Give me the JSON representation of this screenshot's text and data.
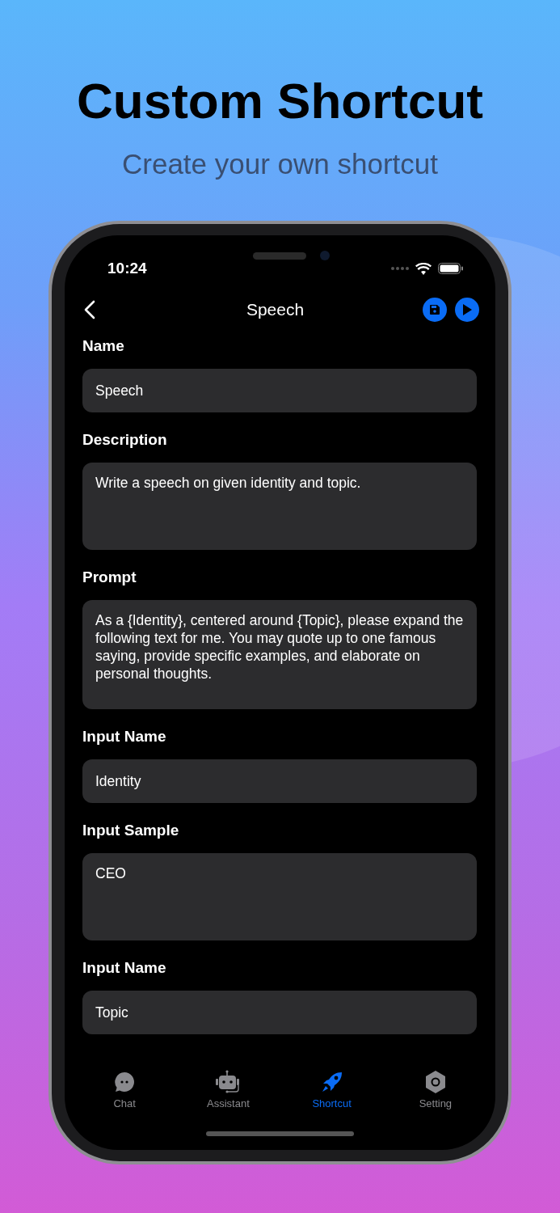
{
  "headline": "Custom Shortcut",
  "subheadline": "Create your own shortcut",
  "status_bar": {
    "time": "10:24"
  },
  "nav": {
    "title": "Speech"
  },
  "fields": [
    {
      "label": "Name",
      "kind": "single",
      "value": "Speech"
    },
    {
      "label": "Description",
      "kind": "multi",
      "value": "Write a speech on given identity and topic."
    },
    {
      "label": "Prompt",
      "kind": "long",
      "value": "As a {Identity}, centered around {Topic}, please expand the following text for me. You may quote up to one famous saying, provide specific examples, and elaborate on personal thoughts."
    },
    {
      "label": "Input Name",
      "kind": "single",
      "value": "Identity"
    },
    {
      "label": "Input Sample",
      "kind": "multi",
      "value": "CEO"
    },
    {
      "label": "Input Name",
      "kind": "single",
      "value": "Topic"
    }
  ],
  "tabs": [
    {
      "label": "Chat",
      "selected": false
    },
    {
      "label": "Assistant",
      "selected": false
    },
    {
      "label": "Shortcut",
      "selected": true
    },
    {
      "label": "Setting",
      "selected": false
    }
  ]
}
